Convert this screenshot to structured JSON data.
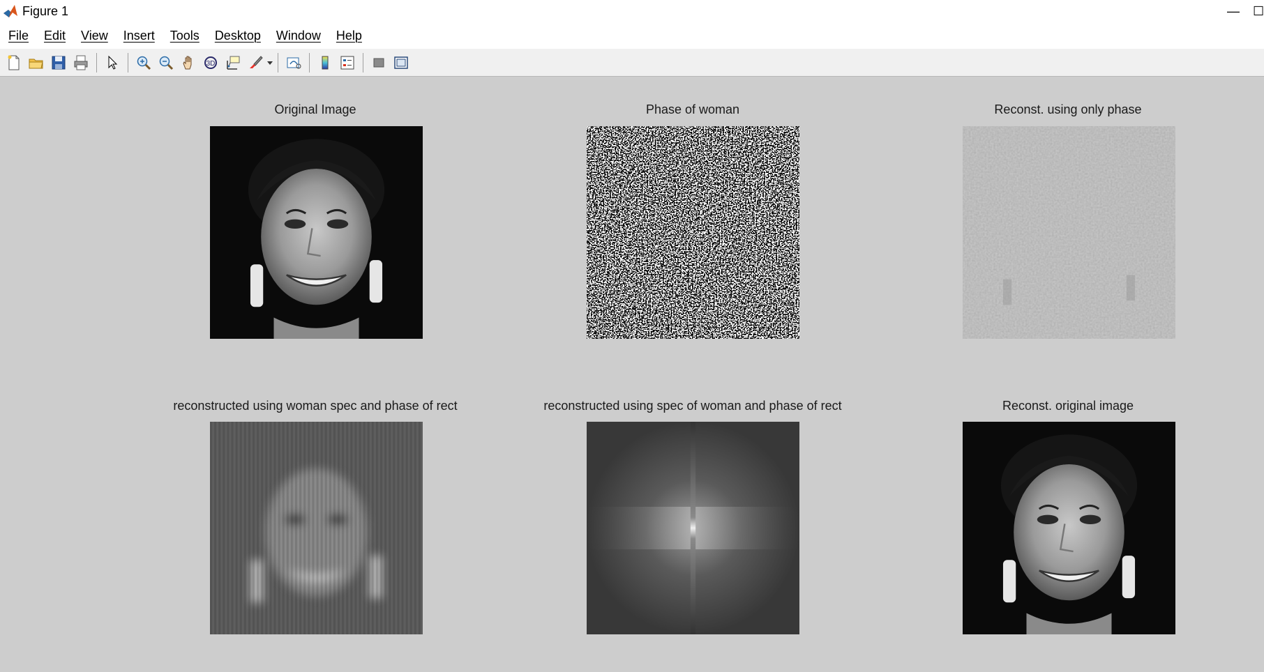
{
  "window": {
    "title": "Figure 1",
    "minimize_glyph": "—",
    "maximize_glyph": "☐"
  },
  "menu": [
    "File",
    "Edit",
    "View",
    "Insert",
    "Tools",
    "Desktop",
    "Window",
    "Help"
  ],
  "toolbar": {
    "icons": [
      "new-figure-icon",
      "open-file-icon",
      "save-icon",
      "print-icon",
      "pointer-icon",
      "zoom-in-icon",
      "zoom-out-icon",
      "pan-icon",
      "rotate-3d-icon",
      "data-cursor-icon",
      "brush-icon",
      "link-plot-icon",
      "colorbar-icon",
      "legend-icon",
      "hide-plot-tools-icon",
      "show-plot-tools-icon"
    ]
  },
  "subplots": [
    {
      "title": "Original Image",
      "image": "face"
    },
    {
      "title": "Phase of woman",
      "image": "phase-noise"
    },
    {
      "title": "Reconst. using only phase",
      "image": "gray-flat"
    },
    {
      "title": "reconstructed using woman spec and phase of rect",
      "image": "blurred-face"
    },
    {
      "title": "reconstructed using spec of woman and phase of rect",
      "image": "spectrum-cross"
    },
    {
      "title": "Reconst. original image",
      "image": "face"
    }
  ],
  "colors": {
    "titlebar": "#ffffff",
    "menubar": "#ffffff",
    "toolbar": "#f0f0f0",
    "figure_bg": "#cdcdcd"
  }
}
